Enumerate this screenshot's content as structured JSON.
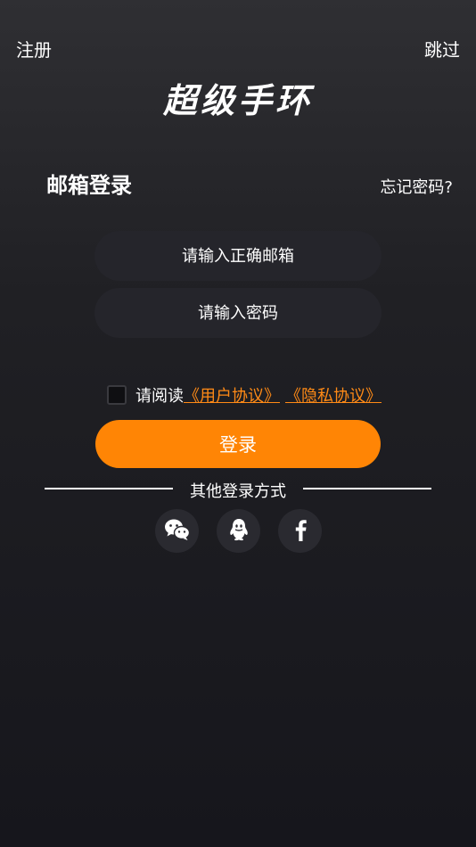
{
  "header": {
    "register_label": "注册",
    "skip_label": "跳过",
    "logo_text": "超级手环"
  },
  "login": {
    "title": "邮箱登录",
    "forgot_label": "忘记密码?",
    "email_placeholder": "请输入正确邮箱",
    "password_placeholder": "请输入密码",
    "agree_prefix": "请阅读",
    "user_agreement": "《用户协议》",
    "privacy_agreement": "《隐私协议》",
    "submit_label": "登录"
  },
  "other": {
    "label": "其他登录方式",
    "providers": [
      "wechat-icon",
      "qq-icon",
      "facebook-icon"
    ]
  },
  "colors": {
    "accent": "#ff8505",
    "link": "#ff8a16"
  }
}
